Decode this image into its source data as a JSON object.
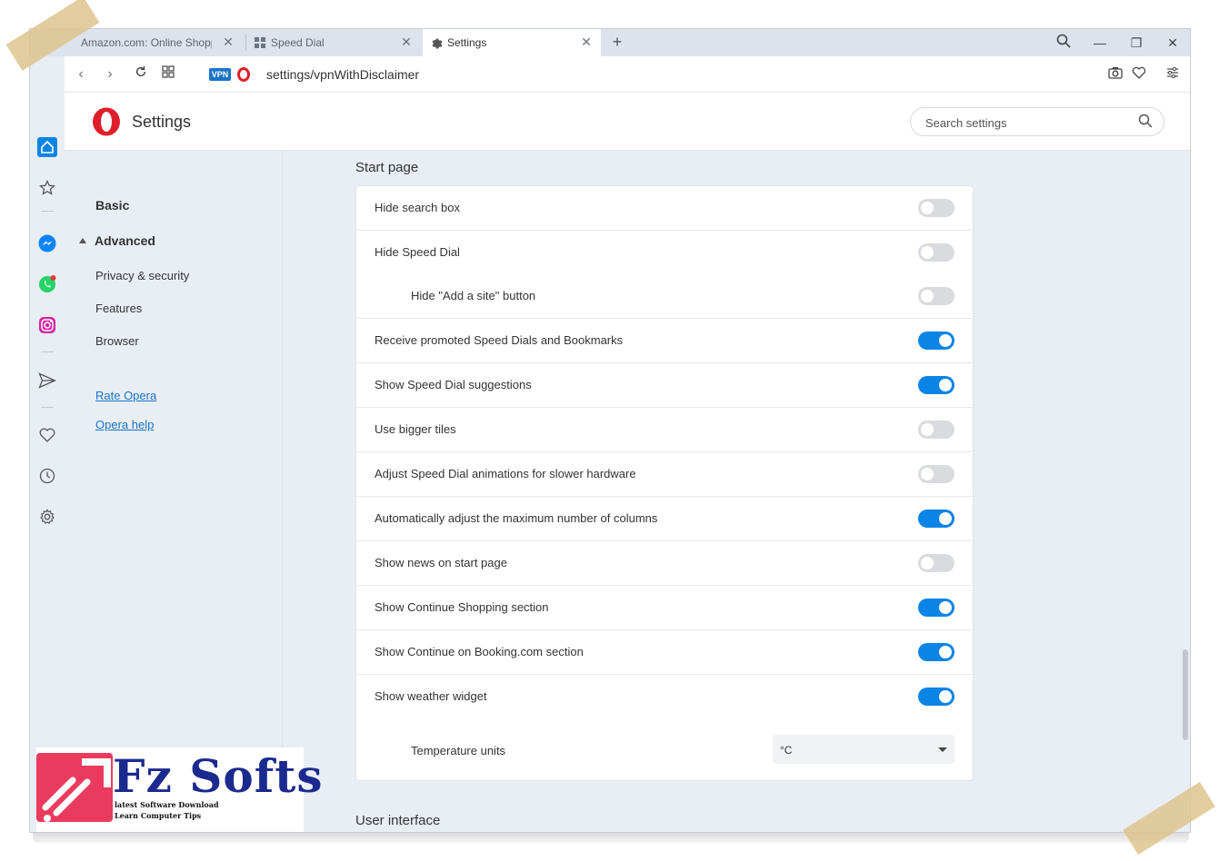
{
  "tabs": [
    {
      "label": "Amazon.com: Online Shopp",
      "active": false
    },
    {
      "label": "Speed Dial",
      "active": false
    },
    {
      "label": "Settings",
      "active": true
    }
  ],
  "address_bar": {
    "vpn_label": "VPN",
    "url": "settings/vpnWithDisclaimer"
  },
  "header": {
    "title": "Settings",
    "search_placeholder": "Search settings"
  },
  "leftnav": {
    "basic": "Basic",
    "advanced": "Advanced",
    "items": [
      "Privacy & security",
      "Features",
      "Browser"
    ],
    "links": [
      "Rate Opera",
      "Opera help"
    ]
  },
  "start_page": {
    "title": "Start page",
    "rows": [
      {
        "label": "Hide search box",
        "on": false
      },
      {
        "label": "Hide Speed Dial",
        "on": false
      },
      {
        "label": "Hide \"Add a site\" button",
        "on": false
      },
      {
        "label": "Receive promoted Speed Dials and Bookmarks",
        "on": true
      },
      {
        "label": "Show Speed Dial suggestions",
        "on": true
      },
      {
        "label": "Use bigger tiles",
        "on": false
      },
      {
        "label": "Adjust Speed Dial animations for slower hardware",
        "on": false
      },
      {
        "label": "Automatically adjust the maximum number of columns",
        "on": true
      },
      {
        "label": "Show news on start page",
        "on": false
      },
      {
        "label": "Show Continue Shopping section",
        "on": true
      },
      {
        "label": "Show Continue on Booking.com section",
        "on": true
      },
      {
        "label": "Show weather widget",
        "on": true
      }
    ],
    "temperature": {
      "label": "Temperature units",
      "value": "°C"
    }
  },
  "next_section": "User interface",
  "watermark": {
    "title": "Fz Softs",
    "line1": "latest Software Download",
    "line2": "Learn Computer Tips"
  },
  "colors": {
    "accent": "#0a84e6",
    "opera_red": "#e01e2b",
    "toggle_off": "#d9dbdf"
  }
}
